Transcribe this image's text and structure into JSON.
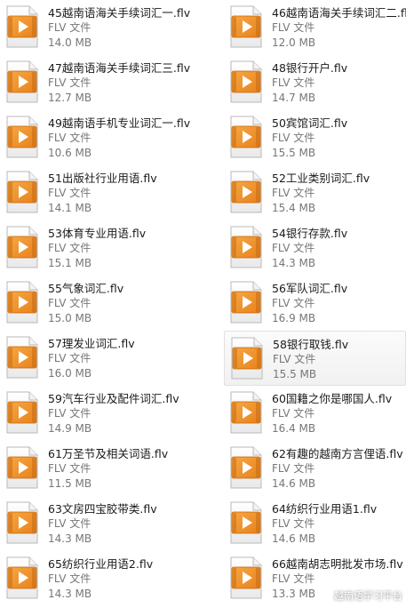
{
  "colors": {
    "icon_orange": "#e8821c",
    "icon_orange_light": "#f6a743",
    "play_white": "#ffffff",
    "name_text": "#1a1a1a",
    "meta_text": "#777777"
  },
  "files": [
    {
      "name": "45越南语海关手续词汇一.flv",
      "type": "FLV 文件",
      "size": "14.0 MB",
      "icon": "flv-video-icon"
    },
    {
      "name": "46越南语海关手续词汇二.flv",
      "type": "FLV 文件",
      "size": "12.0 MB",
      "icon": "flv-video-icon"
    },
    {
      "name": "47越南语海关手续词汇三.flv",
      "type": "FLV 文件",
      "size": "12.7 MB",
      "icon": "flv-video-icon"
    },
    {
      "name": "48银行开户.flv",
      "type": "FLV 文件",
      "size": "14.7 MB",
      "icon": "flv-video-icon"
    },
    {
      "name": "49越南语手机专业词汇一.flv",
      "type": "FLV 文件",
      "size": "10.6 MB",
      "icon": "flv-video-icon"
    },
    {
      "name": "50宾馆词汇.flv",
      "type": "FLV 文件",
      "size": "15.5 MB",
      "icon": "flv-video-icon"
    },
    {
      "name": "51出版社行业用语.flv",
      "type": "FLV 文件",
      "size": "14.1 MB",
      "icon": "flv-video-icon"
    },
    {
      "name": "52工业类别词汇.flv",
      "type": "FLV 文件",
      "size": "15.4 MB",
      "icon": "flv-video-icon"
    },
    {
      "name": "53体育专业用语.flv",
      "type": "FLV 文件",
      "size": "15.1 MB",
      "icon": "flv-video-icon"
    },
    {
      "name": "54银行存款.flv",
      "type": "FLV 文件",
      "size": "14.3 MB",
      "icon": "flv-video-icon"
    },
    {
      "name": "55气象词汇.flv",
      "type": "FLV 文件",
      "size": "15.0 MB",
      "icon": "flv-video-icon"
    },
    {
      "name": "56军队词汇.flv",
      "type": "FLV 文件",
      "size": "16.9 MB",
      "icon": "flv-video-icon"
    },
    {
      "name": "57理发业词汇.flv",
      "type": "FLV 文件",
      "size": "16.0 MB",
      "icon": "flv-video-icon"
    },
    {
      "name": "58银行取钱.flv",
      "type": "FLV 文件",
      "size": "15.5 MB",
      "icon": "flv-video-icon",
      "selected": true
    },
    {
      "name": "59汽车行业及配件词汇.flv",
      "type": "FLV 文件",
      "size": "14.9 MB",
      "icon": "flv-video-icon"
    },
    {
      "name": "60国籍之你是哪国人.flv",
      "type": "FLV 文件",
      "size": "16.4 MB",
      "icon": "flv-video-icon"
    },
    {
      "name": "61万圣节及相关词语.flv",
      "type": "FLV 文件",
      "size": "11.5 MB",
      "icon": "flv-video-icon"
    },
    {
      "name": "62有趣的越南方言俚语.flv",
      "type": "FLV 文件",
      "size": "14.6 MB",
      "icon": "flv-video-icon"
    },
    {
      "name": "63文房四宝胶带类.flv",
      "type": "FLV 文件",
      "size": "14.3 MB",
      "icon": "flv-video-icon"
    },
    {
      "name": "64纺织行业用语1.flv",
      "type": "FLV 文件",
      "size": "14.6 MB",
      "icon": "flv-video-icon"
    },
    {
      "name": "65纺织行业用语2.flv",
      "type": "FLV 文件",
      "size": "14.3 MB",
      "icon": "flv-video-icon"
    },
    {
      "name": "66越南胡志明批发市场.flv",
      "type": "FLV 文件",
      "size": "13.3 MB",
      "icon": "flv-video-icon"
    }
  ],
  "watermark": {
    "text": "越南语学习平台",
    "icon": "wechat-channel-icon"
  }
}
